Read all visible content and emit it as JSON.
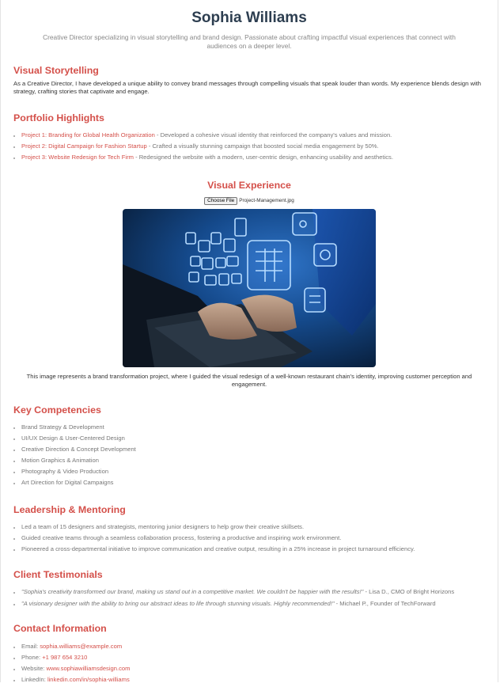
{
  "header": {
    "name": "Sophia Williams",
    "tagline": "Creative Director specializing in visual storytelling and brand design. Passionate about crafting impactful visual experiences that connect with audiences on a deeper level."
  },
  "visual_storytelling": {
    "title": "Visual Storytelling",
    "text": "As a Creative Director, I have developed a unique ability to convey brand messages through compelling visuals that speak louder than words. My experience blends design with strategy, crafting stories that captivate and engage."
  },
  "portfolio": {
    "title": "Portfolio Highlights",
    "items": [
      {
        "link": "Project 1: Branding for Global Health Organization",
        "desc": " - Developed a cohesive visual identity that reinforced the company's values and mission."
      },
      {
        "link": "Project 2: Digital Campaign for Fashion Startup",
        "desc": " - Crafted a visually stunning campaign that boosted social media engagement by 50%."
      },
      {
        "link": "Project 3: Website Redesign for Tech Firm",
        "desc": " - Redesigned the website with a modern, user-centric design, enhancing usability and aesthetics."
      }
    ]
  },
  "visual_experience": {
    "title": "Visual Experience",
    "file_button": "Choose File",
    "file_name": "Project-Management.jpg",
    "caption": "This image represents a brand transformation project, where I guided the visual redesign of a well-known restaurant chain's identity, improving customer perception and engagement."
  },
  "competencies": {
    "title": "Key Competencies",
    "items": [
      "Brand Strategy & Development",
      "UI/UX Design & User-Centered Design",
      "Creative Direction & Concept Development",
      "Motion Graphics & Animation",
      "Photography & Video Production",
      "Art Direction for Digital Campaigns"
    ]
  },
  "leadership": {
    "title": "Leadership & Mentoring",
    "items": [
      "Led a team of 15 designers and strategists, mentoring junior designers to help grow their creative skillsets.",
      "Guided creative teams through a seamless collaboration process, fostering a productive and inspiring work environment.",
      "Pioneered a cross-departmental initiative to improve communication and creative output, resulting in a 25% increase in project turnaround efficiency."
    ]
  },
  "testimonials": {
    "title": "Client Testimonials",
    "items": [
      {
        "quote": "\"Sophia's creativity transformed our brand, making us stand out in a competitive market. We couldn't be happier with the results!\"",
        "author": " - Lisa D., CMO of Bright Horizons"
      },
      {
        "quote": "\"A visionary designer with the ability to bring our abstract ideas to life through stunning visuals. Highly recommended!\"",
        "author": " - Michael P., Founder of TechForward"
      }
    ]
  },
  "contact": {
    "title": "Contact Information",
    "email_label": "Email: ",
    "email": "sophia.williams@example.com",
    "phone_label": "Phone: ",
    "phone": "+1 987 654 3210",
    "website_label": "Website: ",
    "website": "www.sophiawilliamsdesign.com",
    "linkedin_label": "LinkedIn: ",
    "linkedin": "linkedin.com/in/sophia-williams"
  },
  "colors": {
    "accent": "#d4504a",
    "heading": "#2d3e50",
    "muted": "#777777"
  }
}
